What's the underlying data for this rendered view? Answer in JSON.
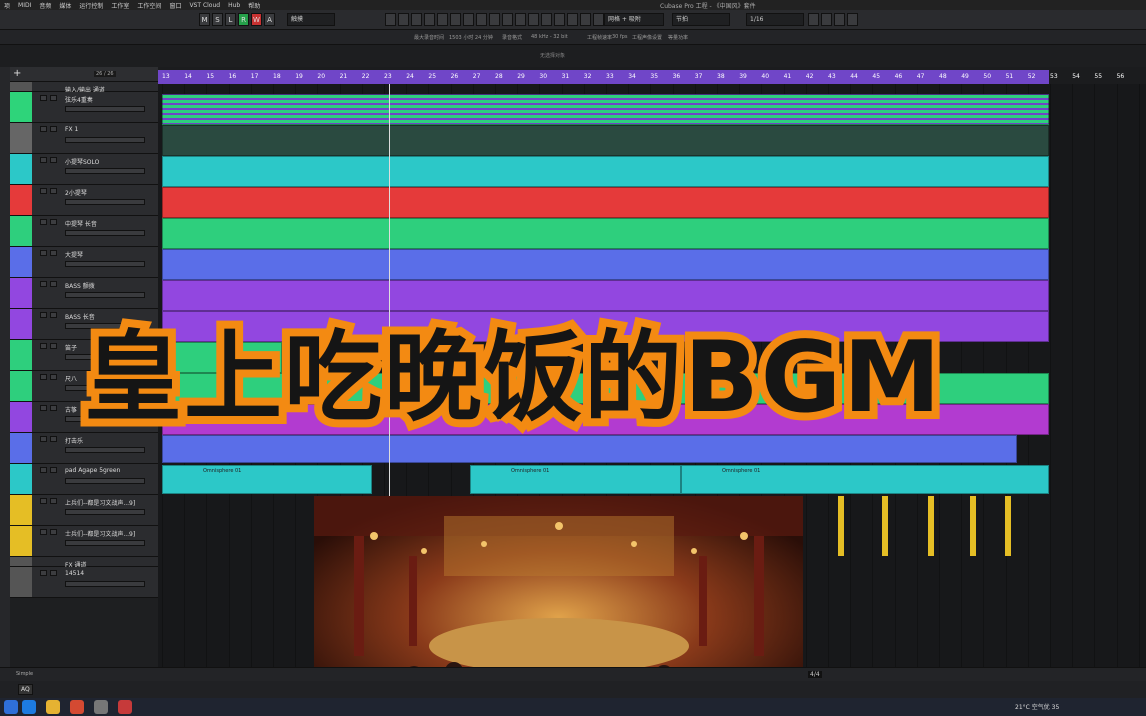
{
  "menu": [
    "项",
    "MIDI",
    "音频",
    "媒体",
    "运行控制",
    "工作室",
    "工作空间",
    "窗口",
    "VST Cloud",
    "Hub",
    "帮助"
  ],
  "window_title": "Cubase Pro 工程 - 《中国风》套件",
  "toolbar": {
    "mode_buttons": [
      "M",
      "S",
      "L",
      "R",
      "W",
      "A"
    ],
    "touch_mode": "触摸",
    "grid_type": "网格 + 吸附",
    "snap_type": "节拍",
    "quantize": "1/16"
  },
  "infobar": [
    "最大录音时间",
    "1503 小时 24 分钟",
    "录音格式",
    "48 kHz - 32 bit",
    "工程帧速率",
    "30 fps",
    "工程声像设置",
    "等量功率"
  ],
  "subbar_label": "无选择对象",
  "tracklist_count": "26 / 26",
  "ruler_bars": [
    "13",
    "14",
    "15",
    "16",
    "17",
    "18",
    "19",
    "20",
    "21",
    "22",
    "23",
    "24",
    "25",
    "26",
    "27",
    "28",
    "29",
    "30",
    "31",
    "32",
    "33",
    "34",
    "35",
    "36",
    "37",
    "38",
    "39",
    "40",
    "41",
    "42",
    "43",
    "44",
    "45",
    "46",
    "47",
    "48",
    "49",
    "50",
    "51",
    "52",
    "53",
    "54",
    "55",
    "56"
  ],
  "tracks": [
    {
      "name": "输入/输出 通道"
    },
    {
      "name": "弦乐4重奏"
    },
    {
      "name": "FX 1"
    },
    {
      "name": "小提琴SOLO"
    },
    {
      "name": "2小提琴"
    },
    {
      "name": "中提琴 长音"
    },
    {
      "name": "大提琴"
    },
    {
      "name": "BASS 颤拨"
    },
    {
      "name": "BASS 长音"
    },
    {
      "name": "笛子"
    },
    {
      "name": "尺八"
    },
    {
      "name": "古筝"
    },
    {
      "name": "打击乐"
    },
    {
      "name": "pad Agape 5green"
    },
    {
      "name": "上兵们--都是习文战声...9]"
    },
    {
      "name": "士兵们--都是习文战声...9]"
    },
    {
      "name": "FX 通道"
    },
    {
      "name": "14514"
    }
  ],
  "clip_label": "Omnisphere 01",
  "overlay_title": "皇上吃晚饭的BGM",
  "statusbar": {
    "simple": "Simple",
    "time_sig": "4/4"
  },
  "aq": "AQ",
  "tray": {
    "temp": "21°C",
    "weather": "空气优 35"
  },
  "colors": {
    "ruler": "#7046c8",
    "cyan": "#2cc8c8",
    "red": "#e53a3a",
    "green": "#2ecf7d",
    "blue": "#5a6ee8",
    "purple": "#9247e0",
    "gold": "#e5be25",
    "overlay_stroke": "#f38a12"
  }
}
